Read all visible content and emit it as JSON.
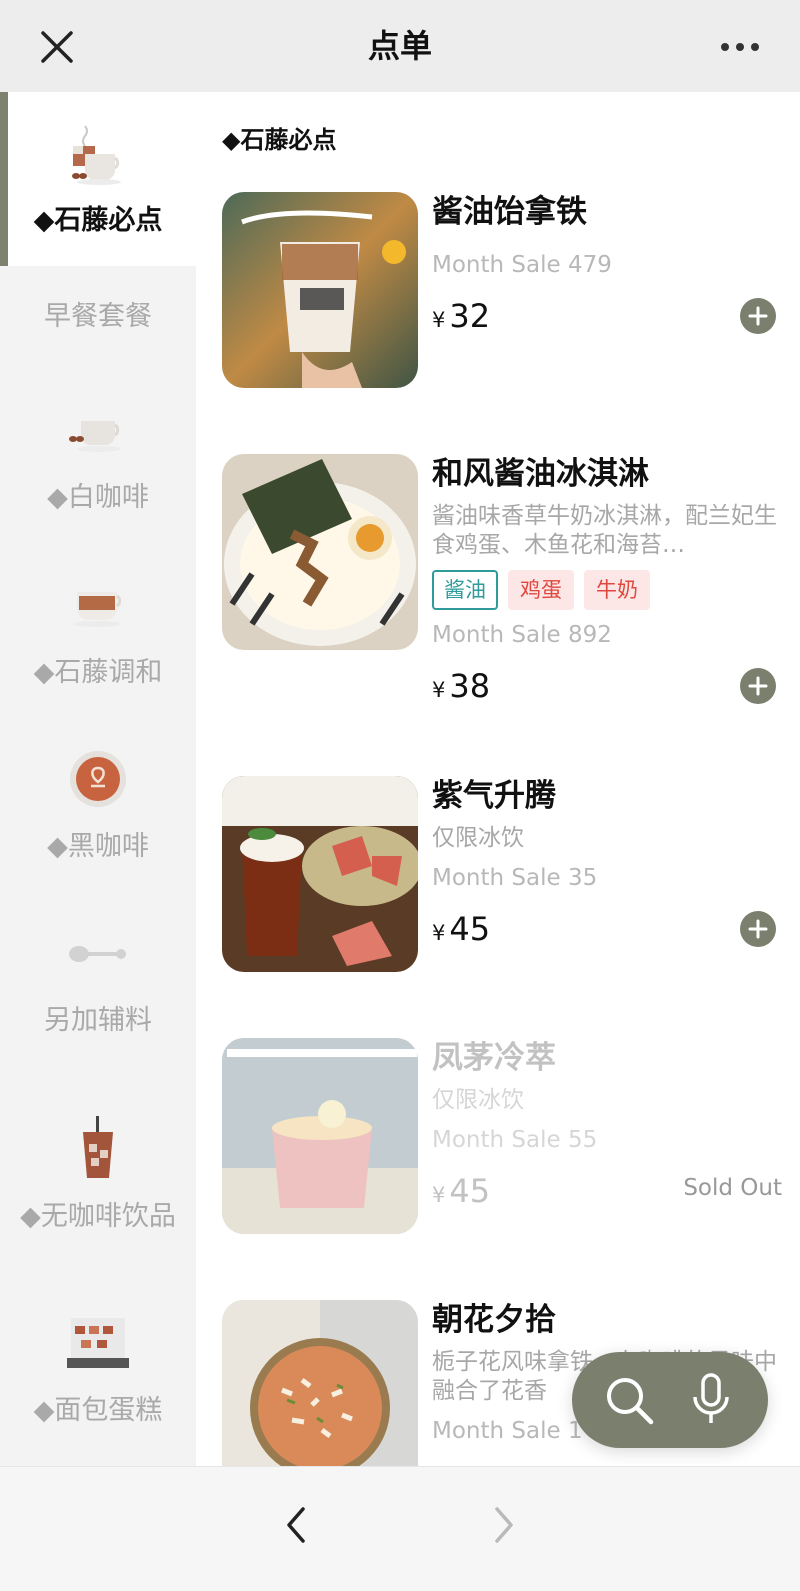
{
  "header": {
    "title": "点单",
    "close_icon": "close-icon",
    "more_icon": "more-dots-icon"
  },
  "sidebar": {
    "items": [
      {
        "label": "◆石藤必点",
        "icon": "coffee-cup-icon",
        "active": true
      },
      {
        "label": "早餐套餐",
        "icon": "",
        "active": false
      },
      {
        "label": "◆白咖啡",
        "icon": "white-coffee-icon",
        "active": false
      },
      {
        "label": "◆石藤调和",
        "icon": "blend-coffee-icon",
        "active": false
      },
      {
        "label": "◆黑咖啡",
        "icon": "latte-art-icon",
        "active": false
      },
      {
        "label": "另加辅料",
        "icon": "spoon-icon",
        "active": false
      },
      {
        "label": "◆无咖啡饮品",
        "icon": "iced-drink-icon",
        "active": false
      },
      {
        "label": "◆面包蛋糕",
        "icon": "cake-display-icon",
        "active": false
      }
    ]
  },
  "content": {
    "section_title": "◆石藤必点",
    "items": [
      {
        "name": "酱油饴拿铁",
        "desc": "",
        "tags": [],
        "sale": "Month Sale 479",
        "currency": "¥",
        "price": "32",
        "sold_out": false,
        "image": "soy-latte-photo"
      },
      {
        "name": "和风酱油冰淇淋",
        "desc": "酱油味香草牛奶冰淇淋，配兰妃生食鸡蛋、木鱼花和海苔…",
        "tags": [
          {
            "label": "酱油",
            "style": "teal"
          },
          {
            "label": "鸡蛋",
            "style": "pink"
          },
          {
            "label": "牛奶",
            "style": "pink"
          }
        ],
        "sale": "Month Sale 892",
        "currency": "¥",
        "price": "38",
        "sold_out": false,
        "image": "ice-cream-bowl-photo"
      },
      {
        "name": "紫气升腾",
        "desc": "仅限冰饮",
        "tags": [],
        "sale": "Month Sale 35",
        "currency": "¥",
        "price": "45",
        "sold_out": false,
        "image": "guava-drink-photo"
      },
      {
        "name": "凤茅冷萃",
        "desc": "仅限冰饮",
        "tags": [],
        "sale": "Month Sale 55",
        "currency": "¥",
        "price": "45",
        "sold_out": true,
        "sold_out_label": "Sold Out",
        "image": "cold-brew-photo"
      },
      {
        "name": "朝花夕拾",
        "desc": "栀子花风味拿铁，在咖啡的风味中融合了花香",
        "tags": [],
        "sale": "Month Sale 1",
        "currency": "¥",
        "price": "",
        "sold_out": false,
        "image": "flower-latte-photo"
      }
    ],
    "add_icon": "plus-icon"
  },
  "float_bar": {
    "search_icon": "search-icon",
    "mic_icon": "microphone-icon"
  },
  "bottom_nav": {
    "back_icon": "chevron-left-icon",
    "forward_icon": "chevron-right-icon"
  },
  "colors": {
    "accent": "#7b806e",
    "tag_teal": "#2f9c9b",
    "tag_pink_text": "#e0473f",
    "tag_pink_bg": "#fde7e6"
  }
}
